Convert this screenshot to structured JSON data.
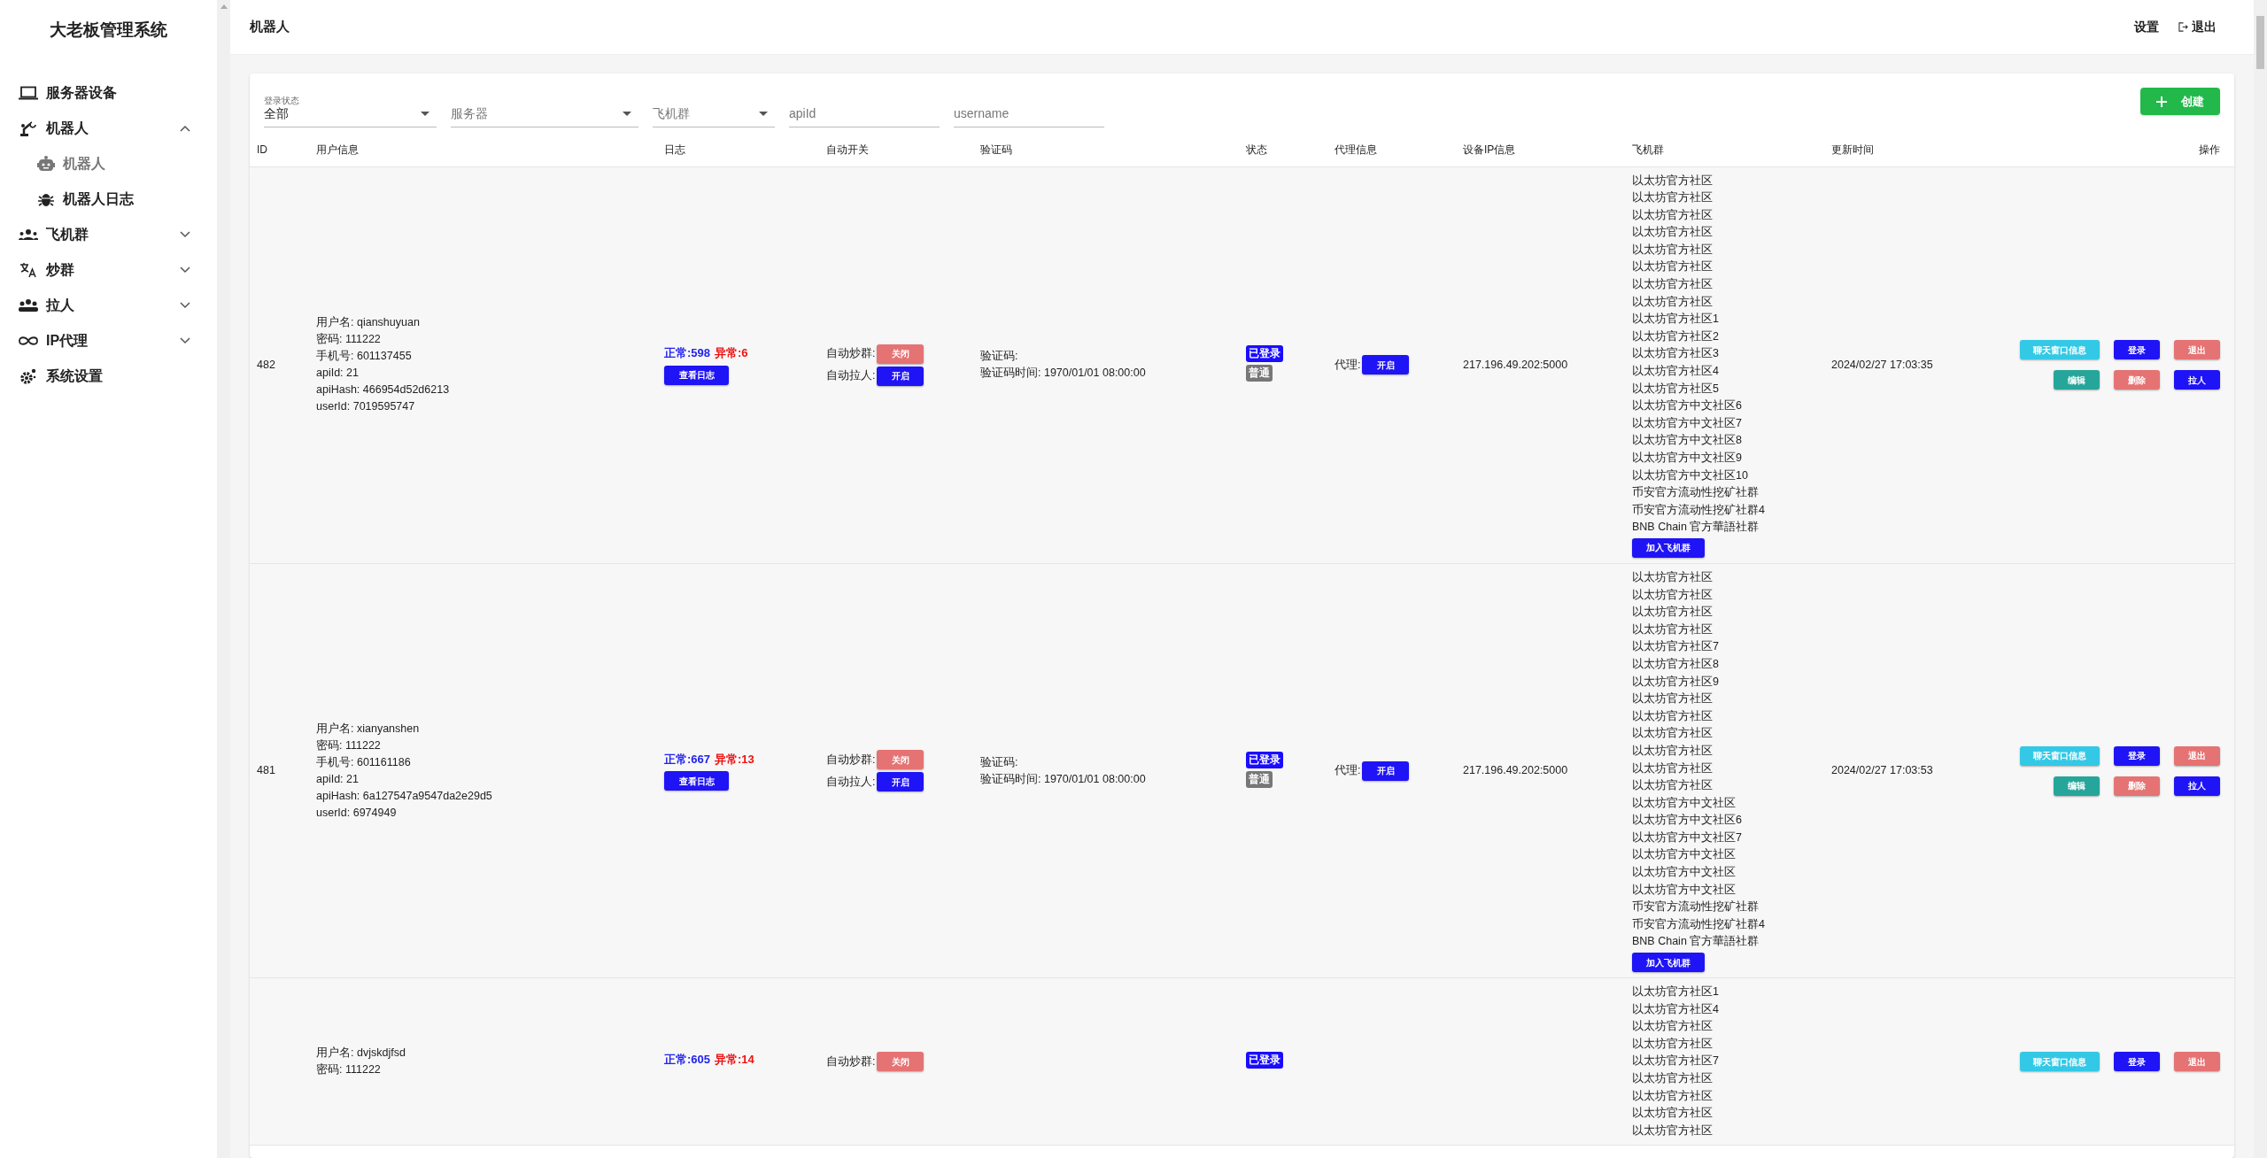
{
  "app_title": "大老板管理系统",
  "sidebar": {
    "items": [
      {
        "label": "服务器设备",
        "selected": false
      },
      {
        "label": "机器人",
        "selected": false,
        "expanded": true,
        "children": [
          {
            "label": "机器人",
            "selected": true
          },
          {
            "label": "机器人日志",
            "selected": false
          }
        ]
      },
      {
        "label": "飞机群",
        "selected": false,
        "expanded": false
      },
      {
        "label": "炒群",
        "selected": false,
        "expanded": false
      },
      {
        "label": "拉人",
        "selected": false,
        "expanded": false
      },
      {
        "label": "IP代理",
        "selected": false,
        "expanded": false
      },
      {
        "label": "系统设置",
        "selected": false
      }
    ]
  },
  "header": {
    "title": "机器人",
    "settings": "设置",
    "logout": "退出"
  },
  "filters": [
    {
      "kind": "select",
      "label": "登录状态",
      "value": "全部"
    },
    {
      "kind": "select",
      "placeholder": "服务器"
    },
    {
      "kind": "select",
      "placeholder": "飞机群"
    },
    {
      "kind": "text",
      "placeholder": "apiId"
    },
    {
      "kind": "text",
      "placeholder": "username"
    }
  ],
  "create_button": "创建",
  "table": {
    "columns": [
      "ID",
      "用户信息",
      "日志",
      "自动开关",
      "验证码",
      "状态",
      "代理信息",
      "设备IP信息",
      "飞机群",
      "更新时间",
      "操作"
    ],
    "rows": [
      {
        "id": "482",
        "user_info": [
          "用户名: qianshuyuan",
          "密码: 111222",
          "手机号: 601137455",
          "apiId: 21",
          "apiHash: 466954d52d6213",
          "userId: 7019595747"
        ],
        "log_normal": "正常:598",
        "log_error": "异常:6",
        "log_button": "查看日志",
        "switches": [
          {
            "label": "自动炒群:",
            "button": "关闭",
            "kind": "off"
          },
          {
            "label": "自动拉人:",
            "button": "开启",
            "kind": "on"
          }
        ],
        "captcha": [
          "验证码:",
          "验证码时间: 1970/01/01 08:00:00"
        ],
        "badges": [
          {
            "text": "已登录",
            "kind": "primary"
          },
          {
            "text": "普通",
            "kind": "secondary"
          }
        ],
        "proxy_label": "代理:",
        "proxy_button": "开启",
        "ip": "217.196.49.202:5000",
        "groups": [
          "以太坊官方社区",
          "以太坊官方社区",
          "以太坊官方社区",
          "以太坊官方社区",
          "以太坊官方社区",
          "以太坊官方社区",
          "以太坊官方社区",
          "以太坊官方社区",
          "以太坊官方社区1",
          "以太坊官方社区2",
          "以太坊官方社区3",
          "以太坊官方社区4",
          "以太坊官方社区5",
          "以太坊官方中文社区6",
          "以太坊官方中文社区7",
          "以太坊官方中文社区8",
          "以太坊官方中文社区9",
          "以太坊官方中文社区10",
          "币安官方流动性挖矿社群",
          "币安官方流动性挖矿社群4",
          "BNB Chain 官方華語社群"
        ],
        "join_button": "加入飞机群",
        "updated": "2024/02/27 17:03:35",
        "actions": [
          {
            "text": "聊天窗口信息",
            "kind": "info"
          },
          {
            "text": "登录",
            "kind": "primary"
          },
          {
            "text": "退出",
            "kind": "danger"
          },
          {
            "text": "编辑",
            "kind": "success"
          },
          {
            "text": "删除",
            "kind": "danger"
          },
          {
            "text": "拉人",
            "kind": "primary"
          }
        ]
      },
      {
        "id": "481",
        "user_info": [
          "用户名: xianyanshen",
          "密码: 111222",
          "手机号: 601161186",
          "apiId: 21",
          "apiHash: 6a127547a9547da2e29d5",
          "userId: 6974949"
        ],
        "log_normal": "正常:667",
        "log_error": "异常:13",
        "log_button": "查看日志",
        "switches": [
          {
            "label": "自动炒群:",
            "button": "关闭",
            "kind": "off"
          },
          {
            "label": "自动拉人:",
            "button": "开启",
            "kind": "on"
          }
        ],
        "captcha": [
          "验证码:",
          "验证码时间: 1970/01/01 08:00:00"
        ],
        "badges": [
          {
            "text": "已登录",
            "kind": "primary"
          },
          {
            "text": "普通",
            "kind": "secondary"
          }
        ],
        "proxy_label": "代理:",
        "proxy_button": "开启",
        "ip": "217.196.49.202:5000",
        "groups": [
          "以太坊官方社区",
          "以太坊官方社区",
          "以太坊官方社区",
          "以太坊官方社区",
          "以太坊官方社区7",
          "以太坊官方社区8",
          "以太坊官方社区9",
          "以太坊官方社区",
          "以太坊官方社区",
          "以太坊官方社区",
          "以太坊官方社区",
          "以太坊官方社区",
          "以太坊官方社区",
          "以太坊官方中文社区",
          "以太坊官方中文社区6",
          "以太坊官方中文社区7",
          "以太坊官方中文社区",
          "以太坊官方中文社区",
          "以太坊官方中文社区",
          "币安官方流动性挖矿社群",
          "币安官方流动性挖矿社群4",
          "BNB Chain 官方華語社群"
        ],
        "join_button": "加入飞机群",
        "updated": "2024/02/27 17:03:53",
        "actions": [
          {
            "text": "聊天窗口信息",
            "kind": "info"
          },
          {
            "text": "登录",
            "kind": "primary"
          },
          {
            "text": "退出",
            "kind": "danger"
          },
          {
            "text": "编辑",
            "kind": "success"
          },
          {
            "text": "删除",
            "kind": "danger"
          },
          {
            "text": "拉人",
            "kind": "primary"
          }
        ]
      },
      {
        "user_info": [
          "用户名: dvjskdjfsd",
          "密码: 111222"
        ],
        "log_normal": "正常:605",
        "log_error": "异常:14",
        "switches": [
          {
            "label": "自动炒群:",
            "button": "关闭",
            "kind": "off"
          }
        ],
        "badges": [
          {
            "text": "已登录",
            "kind": "primary"
          }
        ],
        "groups": [
          "以太坊官方社区1",
          "以太坊官方社区4",
          "以太坊官方社区",
          "以太坊官方社区",
          "以太坊官方社区7",
          "以太坊官方社区",
          "以太坊官方社区",
          "以太坊官方社区",
          "以太坊官方社区"
        ],
        "actions": [
          {
            "text": "聊天窗口信息",
            "kind": "info"
          },
          {
            "text": "登录",
            "kind": "primary"
          },
          {
            "text": "退出",
            "kind": "danger"
          }
        ]
      }
    ]
  }
}
